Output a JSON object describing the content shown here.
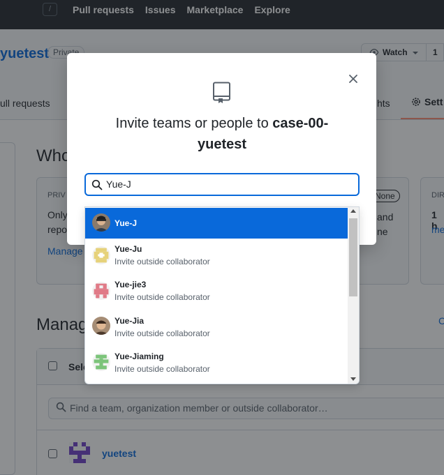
{
  "header": {
    "slash_key": "/",
    "nav": [
      "Pull requests",
      "Issues",
      "Marketplace",
      "Explore"
    ]
  },
  "repo": {
    "name_fragment": "yuetest",
    "visibility": "Private",
    "watch_label": "Watch",
    "watch_count": "1",
    "tabs": {
      "pull_requests": "ull requests",
      "insights": "hts",
      "settings": "Sett"
    }
  },
  "background": {
    "who_title": "Who",
    "priv_label": "PRIV",
    "only_text": "Only",
    "repo_text": "repo",
    "manage_link": "Manage",
    "none_badge": "None",
    "and_text": "and",
    "ne_text": "ne",
    "dir_label": "DIR",
    "one_h": "1 h",
    "me_link": "me",
    "manage_title": "Manag",
    "select_text": "Sele",
    "c_link": "C",
    "find_placeholder": "Find a team, organization member or outside collaborator…",
    "team_name": "yuetest"
  },
  "dialog": {
    "title_prefix": "Invite teams or people to ",
    "repo_bold_line1": "case-00-",
    "repo_bold_line2": "yuetest",
    "search_value": "Yue-J",
    "close_icon": "close-icon"
  },
  "suggestions": [
    {
      "name": "Yue-J",
      "sub": "",
      "selected": true,
      "avatar": "photo"
    },
    {
      "name": "Yue-Ju",
      "sub": "Invite outside collaborator",
      "avatar": "identicon-yellow"
    },
    {
      "name": "Yue-jie3",
      "sub": "Invite outside collaborator",
      "avatar": "identicon-red"
    },
    {
      "name": "Yue-Jia",
      "sub": "Invite outside collaborator",
      "avatar": "photo"
    },
    {
      "name": "Yue-Jiaming",
      "sub": "Invite outside collaborator",
      "avatar": "identicon-green"
    }
  ],
  "colors": {
    "accent": "#0969da",
    "header_bg": "#24292f",
    "tab_underline": "#fd8c73"
  }
}
